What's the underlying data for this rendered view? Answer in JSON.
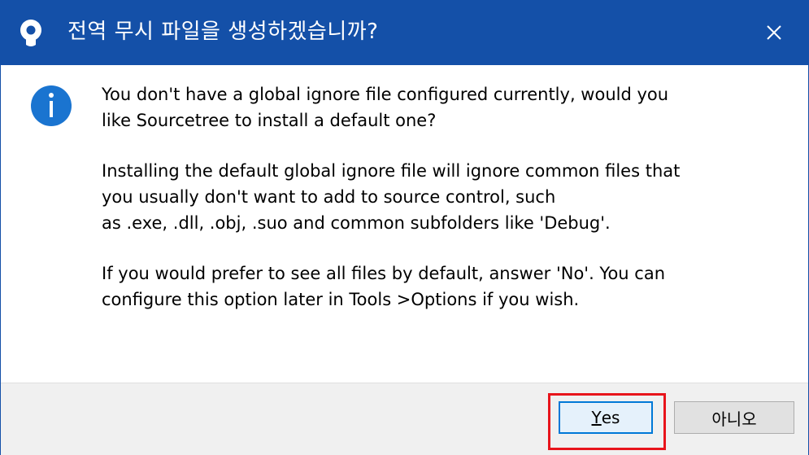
{
  "window": {
    "title": "전역 무시 파일을 생성하겠습니까?",
    "app_icon": "sourcetree-icon",
    "close_glyph": "✕",
    "titlebar_color": "#1450a8"
  },
  "message": {
    "icon": "info-icon",
    "icon_color": "#1a74d0",
    "paragraphs": [
      "You don't have a global ignore file configured currently, would you\nlike Sourcetree to install a default one?",
      "Installing the default global ignore file will ignore common files that\nyou usually don't want to add to source control, such\nas .exe, .dll, .obj, .suo and common subfolders like 'Debug'.",
      "If you would prefer to see all files by default, answer 'No'. You can\nconfigure this option later in Tools >Options if you wish."
    ]
  },
  "buttons": {
    "yes_mnemonic": "Y",
    "yes_rest": "es",
    "no_label": "아니오"
  },
  "highlight_color": "#e8141b"
}
